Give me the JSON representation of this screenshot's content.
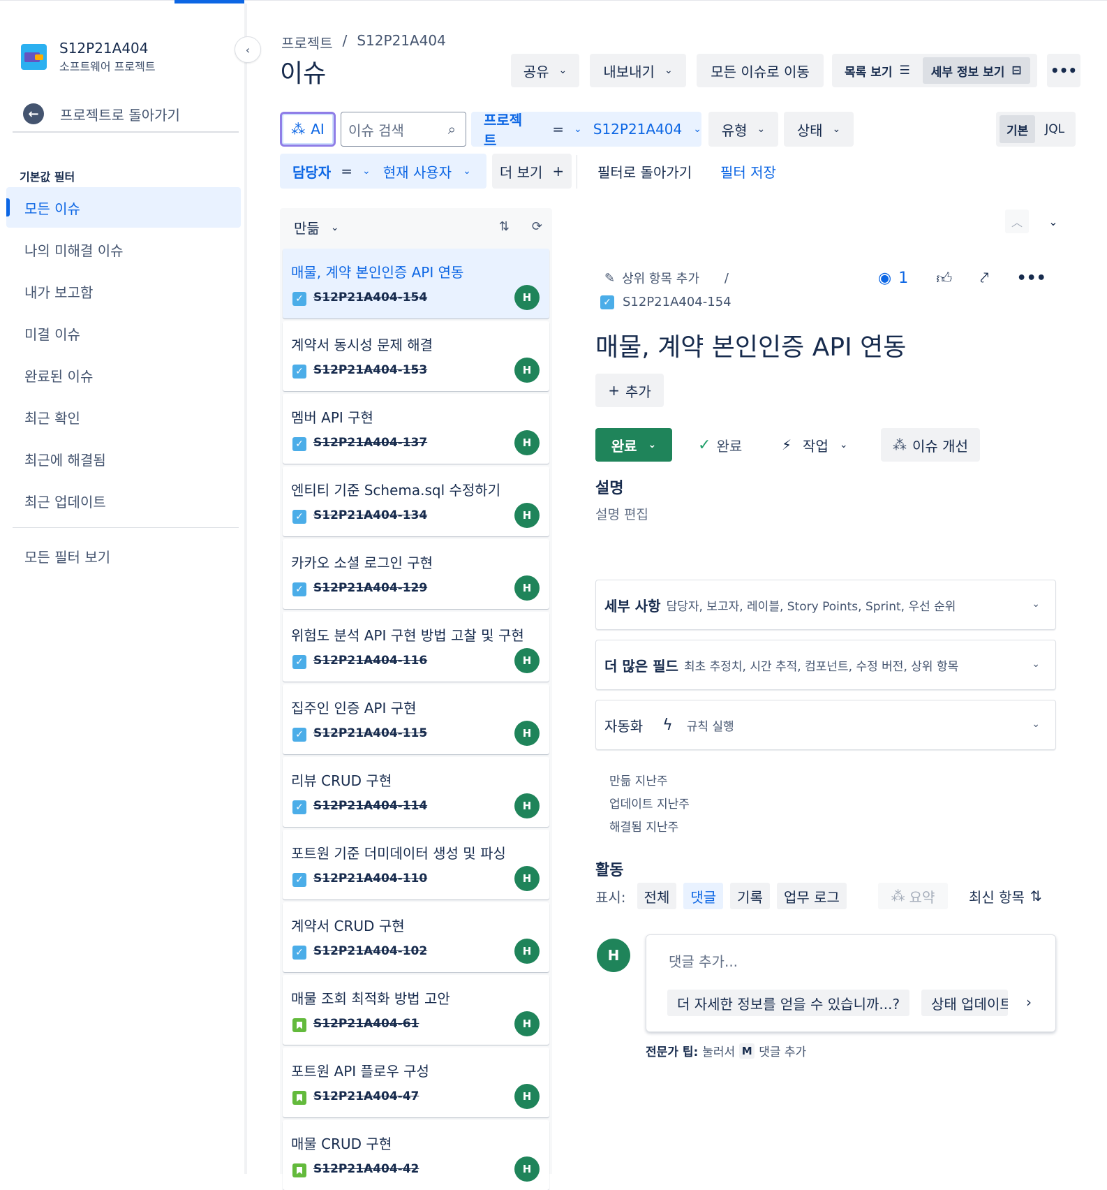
{
  "sidebar": {
    "project_name": "S12P21A404",
    "project_type": "소프트웨어 프로젝트",
    "back_label": "프로젝트로 돌아가기",
    "filters_title": "기본값 필터",
    "filters": [
      "모든 이슈",
      "나의 미해결 이슈",
      "내가 보고함",
      "미결 이슈",
      "완료된 이슈",
      "최근 확인",
      "최근에 해결됨",
      "최근 업데이트"
    ],
    "active_filter": "모든 이슈",
    "all_filters_link": "모든 필터 보기"
  },
  "header": {
    "breadcrumb": [
      "프로젝트",
      "/",
      "S12P21A404"
    ],
    "title": "이슈",
    "share": "공유",
    "export": "내보내기",
    "go_all": "모든 이슈로 이동",
    "list_view": "목록 보기",
    "detail_view": "세부 정보 보기"
  },
  "filterbar": {
    "ai": "AI",
    "search_placeholder": "이슈 검색",
    "project_label": "프로젝트",
    "project_op": "=",
    "project_value": "S12P21A404",
    "type": "유형",
    "status": "상태",
    "mode_basic": "기본",
    "mode_jql": "JQL",
    "assignee_label": "담당자",
    "assignee_op": "=",
    "assignee_value": "현재 사용자",
    "more": "더 보기",
    "back_to_filter": "필터로 돌아가기",
    "save_filter": "필터 저장"
  },
  "list": {
    "sort": "만듦",
    "issues": [
      {
        "title": "매물, 계약 본인인증 API 연동",
        "key": "S12P21A404-154",
        "type": "task",
        "avatar": "H"
      },
      {
        "title": "계약서 동시성 문제 해결",
        "key": "S12P21A404-153",
        "type": "task",
        "avatar": "H"
      },
      {
        "title": "멤버 API 구현",
        "key": "S12P21A404-137",
        "type": "task",
        "avatar": "H"
      },
      {
        "title": "엔티티 기준 Schema.sql 수정하기",
        "key": "S12P21A404-134",
        "type": "task",
        "avatar": "H"
      },
      {
        "title": "카카오 소셜 로그인 구현",
        "key": "S12P21A404-129",
        "type": "task",
        "avatar": "H"
      },
      {
        "title": "위험도 분석 API 구현 방법 고찰 및 구현",
        "key": "S12P21A404-116",
        "type": "task",
        "avatar": "H"
      },
      {
        "title": "집주인 인증 API 구현",
        "key": "S12P21A404-115",
        "type": "task",
        "avatar": "H"
      },
      {
        "title": "리뷰 CRUD 구현",
        "key": "S12P21A404-114",
        "type": "task",
        "avatar": "H"
      },
      {
        "title": "포트원 기준 더미데이터 생성 및 파싱",
        "key": "S12P21A404-110",
        "type": "task",
        "avatar": "H"
      },
      {
        "title": "계약서 CRUD 구현",
        "key": "S12P21A404-102",
        "type": "task",
        "avatar": "H"
      },
      {
        "title": "매물 조회 최적화 방법 고안",
        "key": "S12P21A404-61",
        "type": "story",
        "avatar": "H"
      },
      {
        "title": "포트원 API 플로우 구성",
        "key": "S12P21A404-47",
        "type": "story",
        "avatar": "H"
      },
      {
        "title": "매물 CRUD 구현",
        "key": "S12P21A404-42",
        "type": "story",
        "avatar": "H"
      }
    ]
  },
  "detail": {
    "parent_add": "상위 항목 추가",
    "parent_sep": "/",
    "key": "S12P21A404-154",
    "watch_count": "1",
    "title": "매물, 계약 본인인증 API 연동",
    "add": "추가",
    "status": "완료",
    "resolution": "완료",
    "work": "작업",
    "improve": "이슈 개선",
    "description_label": "설명",
    "description_edit": "설명 편집",
    "details_title": "세부 사항",
    "details_sub": "담당자, 보고자, 레이블, Story Points, Sprint, 우선 순위",
    "more_fields_title": "더 많은 필드",
    "more_fields_sub": "최초 추정치, 시간 추적, 컴포넌트, 수정 버전, 상위 항목",
    "automation_title": "자동화",
    "automation_sub": "규칙 실행",
    "created": "만듦 지난주",
    "updated": "업데이트 지난주",
    "resolved": "해결됨 지난주",
    "activity_label": "활동",
    "show_label": "표시:",
    "tabs": [
      "전체",
      "댓글",
      "기록",
      "업무 로그"
    ],
    "active_tab": "댓글",
    "summary": "요약",
    "newest": "최신 항목",
    "comment_avatar": "H",
    "comment_placeholder": "댓글 추가...",
    "suggestion_1": "더 자세한 정보를 얻을 수 있습니까...?",
    "suggestion_2": "상태 업데이트",
    "tip_bold": "전문가 팁:",
    "tip_text1": "눌러서",
    "tip_key": "M",
    "tip_text2": "댓글 추가"
  },
  "colors": {
    "accent": "#0c66e4",
    "done_green": "#1f845a",
    "ai_border": "#8f7ee7"
  }
}
